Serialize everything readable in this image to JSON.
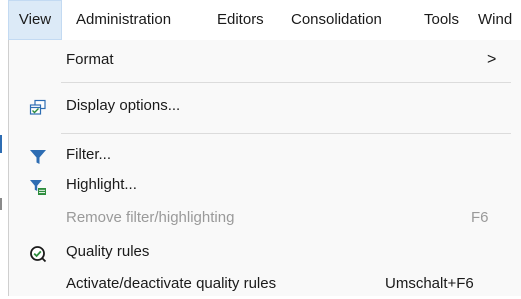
{
  "menubar": {
    "items": [
      {
        "label": "View"
      },
      {
        "label": "Administration"
      },
      {
        "label": "Editors"
      },
      {
        "label": "Consolidation"
      },
      {
        "label": "Tools"
      },
      {
        "label": "Wind"
      }
    ]
  },
  "view_menu": {
    "format": {
      "label": "Format",
      "submenu_arrow": ">"
    },
    "display_options": {
      "label": "Display options...",
      "icon": "display-options-icon"
    },
    "filter": {
      "label": "Filter...",
      "icon": "filter-icon"
    },
    "highlight": {
      "label": "Highlight...",
      "icon": "highlight-filter-icon"
    },
    "remove_filter": {
      "label": "Remove filter/highlighting",
      "shortcut": "F6",
      "enabled": false
    },
    "quality_rules": {
      "label": "Quality rules",
      "icon": "quality-rules-icon"
    },
    "activate_quality_rules": {
      "label": "Activate/deactivate quality rules",
      "shortcut": "Umschalt+F6"
    }
  },
  "colors": {
    "accent_blue": "#2e6db3",
    "menu_bg": "#f9f9f9",
    "disabled_text": "#9a9a9a",
    "quality_green": "#2c8c3c"
  }
}
